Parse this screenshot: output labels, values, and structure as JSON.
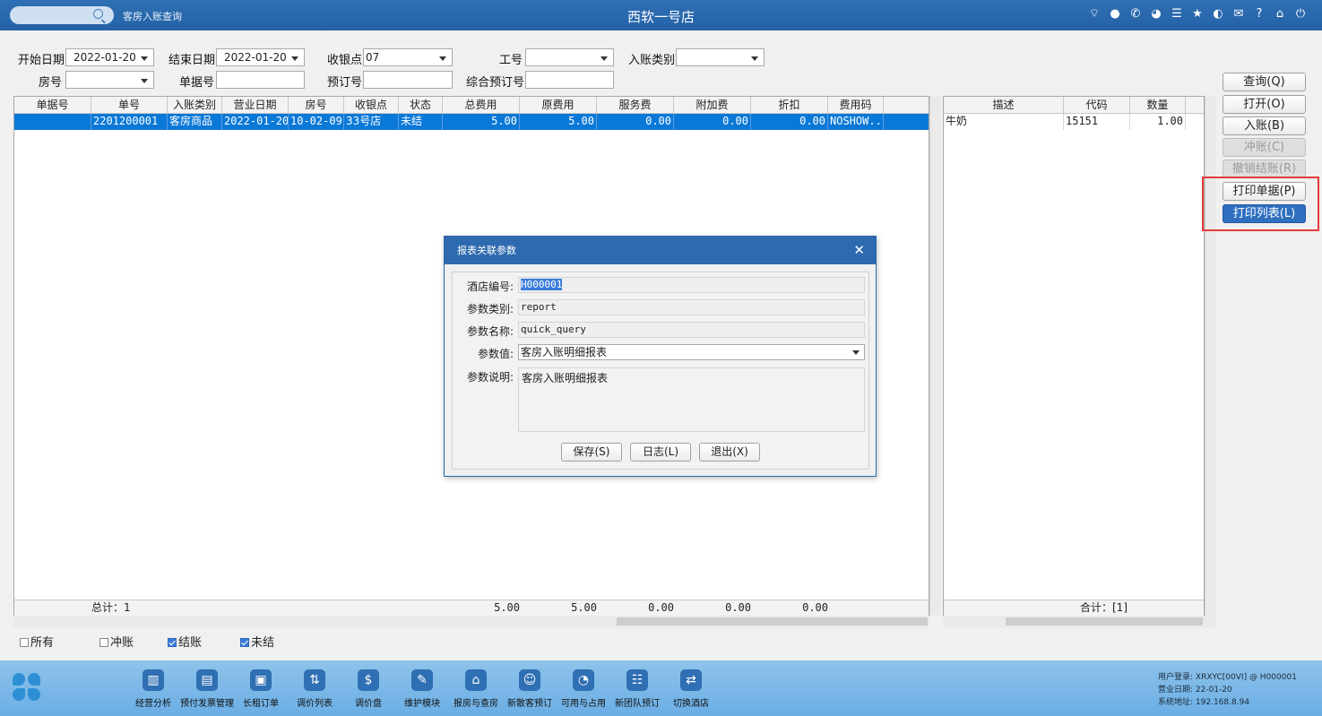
{
  "titlebar": {
    "module": "客房入账查询",
    "title": "西软一号店",
    "icons": [
      "wifi-icon",
      "chat-icon",
      "phone-icon",
      "palette-icon",
      "menu-icon",
      "star-icon",
      "theme-icon",
      "mail-icon",
      "help-icon",
      "home-icon",
      "power-icon"
    ]
  },
  "filters": {
    "start_date_label": "开始日期",
    "start_date": "2022-01-20",
    "end_date_label": "结束日期",
    "end_date": "2022-01-20",
    "cashier_label": "收银点",
    "cashier": "07",
    "worker_label": "工号",
    "worker": "",
    "category_label": "入账类别",
    "category": "",
    "room_label": "房号",
    "room": "",
    "bill_label": "单据号",
    "bill": "",
    "booking_label": "预订号",
    "booking": "",
    "group_booking_label": "综合预订号",
    "group_booking": ""
  },
  "main_grid": {
    "columns": [
      "单据号",
      "单号",
      "入账类别",
      "营业日期",
      "房号",
      "收银点",
      "状态",
      "总费用",
      "原费用",
      "服务费",
      "附加费",
      "折扣",
      "费用码"
    ],
    "rows": [
      [
        "",
        "2201200001",
        "客房商品",
        "2022-01-20",
        "10-02-09",
        "33号店",
        "未结",
        "5.00",
        "5.00",
        "0.00",
        "0.00",
        "0.00",
        "NOSHOW..."
      ]
    ],
    "footer": {
      "total_label": "总计：1",
      "total": "5.00",
      "original": "5.00",
      "service": "0.00",
      "extra": "0.00",
      "discount": "0.00"
    }
  },
  "detail_grid": {
    "columns": [
      "描述",
      "代码",
      "数量"
    ],
    "rows": [
      [
        "牛奶",
        "15151",
        "1.00"
      ]
    ],
    "footer": "合计：[1]"
  },
  "buttons": {
    "query": "查询(Q)",
    "open": "打开(O)",
    "post": "入账(B)",
    "reverse": "冲账(C)",
    "cancel_settle": "撤销结账(R)",
    "print_bill": "打印单据(P)",
    "print_list": "打印列表(L)"
  },
  "checks": {
    "all": "所有",
    "reversed": "冲账",
    "settled": "结账",
    "unsettled": "未结"
  },
  "dialog": {
    "title": "报表关联参数",
    "hotel_code_label": "酒店编号:",
    "hotel_code": "H000001",
    "param_type_label": "参数类别:",
    "param_type": "report",
    "param_name_label": "参数名称:",
    "param_name": "quick_query",
    "param_value_label": "参数值:",
    "param_value": "客房入账明细报表",
    "param_desc_label": "参数说明:",
    "param_desc": "客房入账明细报表",
    "save": "保存(S)",
    "log": "日志(L)",
    "exit": "退出(X)"
  },
  "taskbar": {
    "items": [
      {
        "label": "经营分析",
        "icon": "bar-chart-icon"
      },
      {
        "label": "预付发票管理",
        "icon": "invoice-icon"
      },
      {
        "label": "长租订单",
        "icon": "order-icon"
      },
      {
        "label": "调价列表",
        "icon": "price-list-icon"
      },
      {
        "label": "调价盘",
        "icon": "money-bag-icon"
      },
      {
        "label": "维护模块",
        "icon": "wrench-icon"
      },
      {
        "label": "报房与查房",
        "icon": "house-icon"
      },
      {
        "label": "新散客预订",
        "icon": "guest-icon"
      },
      {
        "label": "可用与占用",
        "icon": "pie-icon"
      },
      {
        "label": "新团队预订",
        "icon": "group-icon"
      },
      {
        "label": "切换酒店",
        "icon": "switch-icon"
      }
    ],
    "user_label": "用户登录:",
    "user": "XRXYC[00VI] @ H000001",
    "bizdate_label": "营业日期:",
    "bizdate": "22-01-20",
    "sysaddr_label": "系统地址:",
    "sysaddr": "192.168.8.94"
  }
}
